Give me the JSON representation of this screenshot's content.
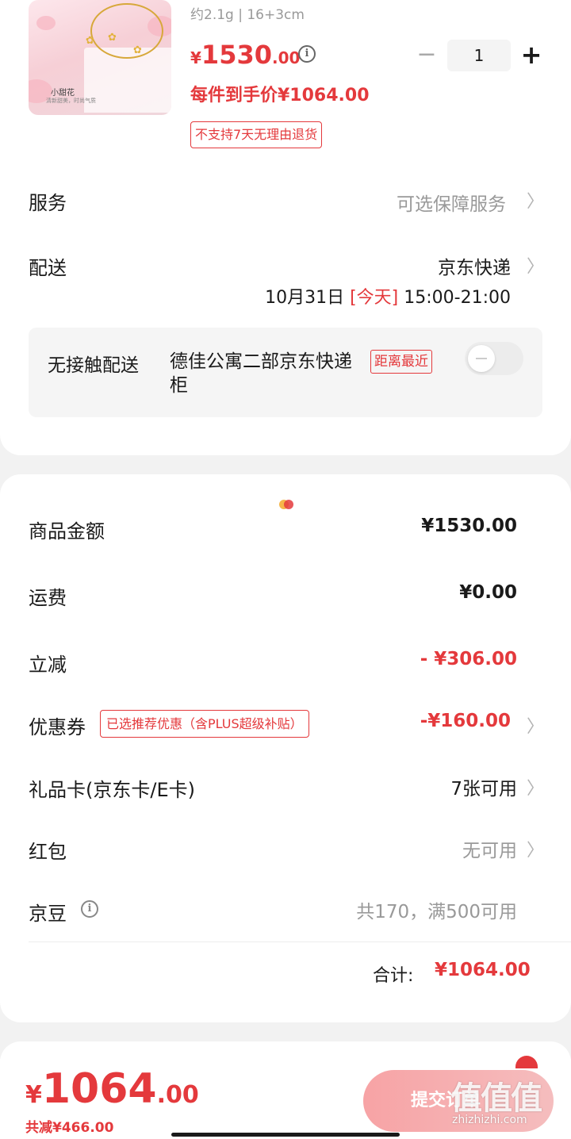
{
  "product": {
    "thumb_title": "小甜花",
    "thumb_subtitle": "清新甜美，时尚气质",
    "spec": "约2.1g | 16+3cm",
    "price_symbol": "¥",
    "price_int": "1530",
    "price_dec": ".00",
    "unit_price": "每件到手价¥1064.00",
    "return_tag": "不支持7天无理由退货",
    "quantity": "1",
    "qty_minus": "−",
    "qty_plus": "+"
  },
  "service": {
    "label": "服务",
    "value": "可选保障服务"
  },
  "delivery": {
    "label": "配送",
    "carrier": "京东快递",
    "date": "10月31日",
    "today": "[今天]",
    "time": "15:00-21:00"
  },
  "contactless": {
    "label": "无接触配送",
    "address": "德佳公寓二部京东快递柜",
    "tag": "距离最近",
    "enabled": false
  },
  "summary": {
    "goods_label": "商品金额",
    "goods_value": "¥1530.00",
    "shipping_label": "运费",
    "shipping_value": "¥0.00",
    "discount_label": "立减",
    "discount_value": "- ¥306.00",
    "coupon_label": "优惠券",
    "coupon_tag": "已选推荐优惠（含PLUS超级补贴）",
    "coupon_value": "-¥160.00",
    "giftcard_label": "礼品卡(京东卡/E卡)",
    "giftcard_value": "7张可用",
    "redpacket_label": "红包",
    "redpacket_value": "无可用",
    "jingdou_label": "京豆",
    "jingdou_value": "共170，满500可用",
    "total_label": "合计:",
    "total_value": "¥1064.00"
  },
  "bottom_bar": {
    "price_symbol": "¥",
    "price_int": "1064",
    "price_dec": ".00",
    "saved": "共减¥466.00",
    "submit_label": "提交订单"
  },
  "watermark": {
    "logo": "值值值",
    "url": "zhizhizhi.com"
  },
  "colors": {
    "accent": "#e4393c",
    "muted": "#999999",
    "background": "#f2f2f2"
  }
}
